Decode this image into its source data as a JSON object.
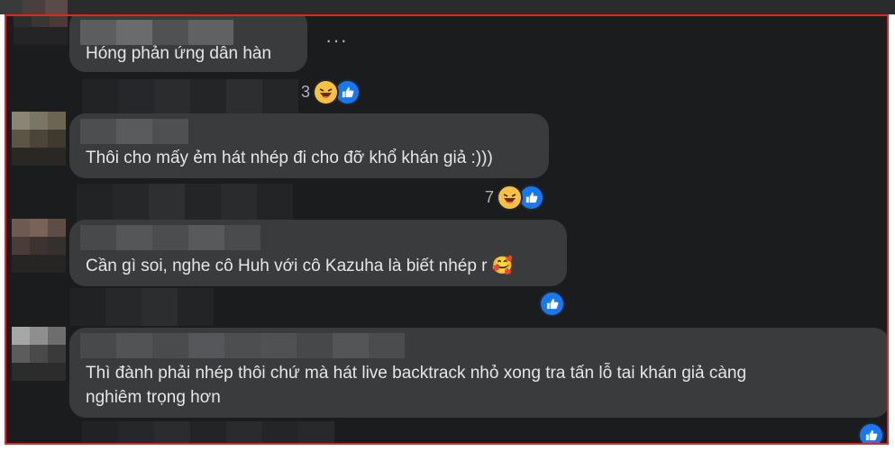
{
  "comments": [
    {
      "text": "Hóng phản ứng dân hàn",
      "reaction_count": "3",
      "reactions": [
        "haha-icon",
        "like-icon"
      ]
    },
    {
      "text": "Thôi cho mấy ẻm hát nhép đi cho đỡ khổ khán giả :)))",
      "reaction_count": "7",
      "reactions": [
        "haha-icon",
        "like-icon"
      ]
    },
    {
      "text": "Cần gì soi, nghe cô Huh với cô Kazuha là biết nhép r",
      "emoji": "🥰",
      "reaction_count": "",
      "reactions": [
        "like-icon"
      ]
    },
    {
      "text_line1": "Thì đành phải nhép thôi chứ mà hát live backtrack nhỏ xong tra tấn lỗ tai khán giả càng",
      "text_line2": "nghiêm trọng hơn",
      "reaction_count": "",
      "reactions": [
        "like-icon"
      ]
    }
  ],
  "more_options_label": "···",
  "colors": {
    "frame_border": "#e0252a",
    "bubble": "#3a3b3c",
    "background": "#1b1c1e",
    "like": "#1877f2",
    "haha": "#f7c241"
  }
}
